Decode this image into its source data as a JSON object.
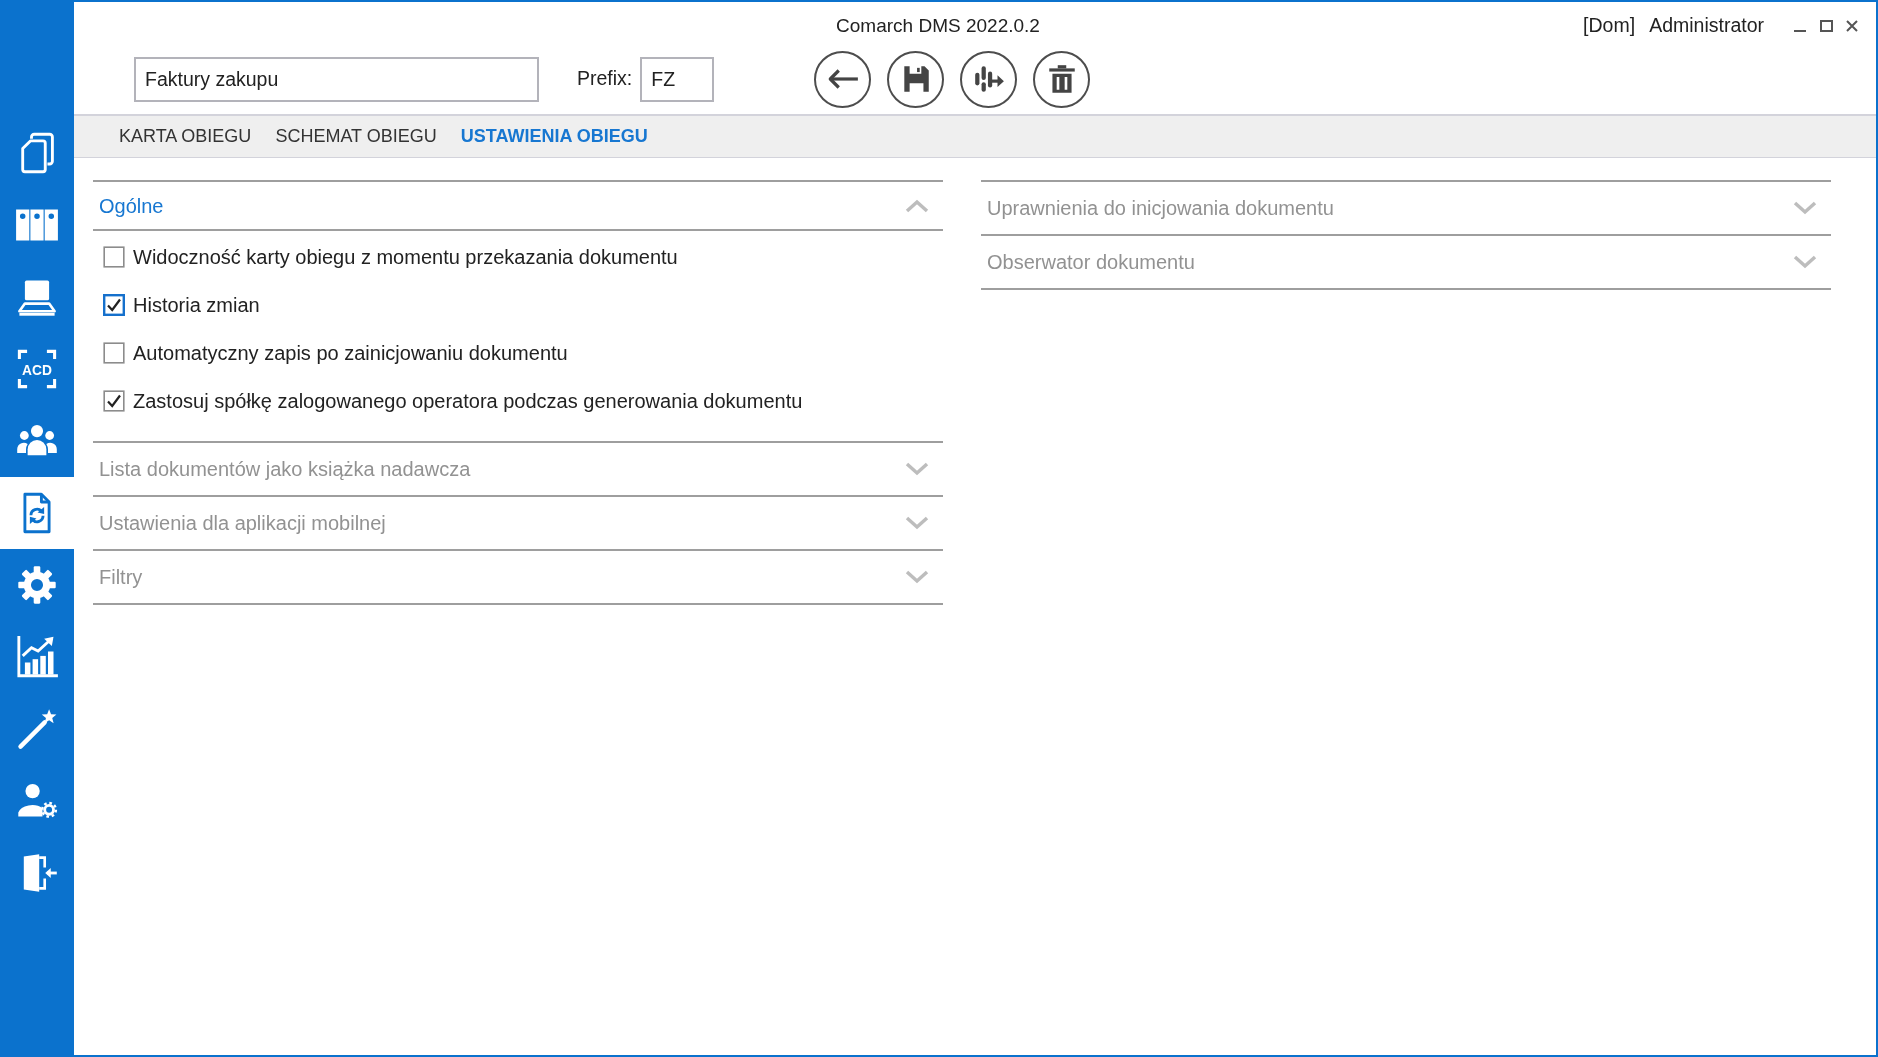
{
  "window": {
    "title": "Comarch DMS 2022.0.2",
    "context": "[Dom]",
    "user": "Administrator"
  },
  "sidebar": {
    "items": [
      {
        "kind": "copies",
        "selected": false
      },
      {
        "kind": "binders",
        "selected": false
      },
      {
        "kind": "scanner",
        "selected": false
      },
      {
        "kind": "ocr",
        "label": "ACD",
        "selected": false
      },
      {
        "kind": "users",
        "selected": false
      },
      {
        "kind": "workflow",
        "selected": true
      },
      {
        "kind": "settings",
        "selected": false
      },
      {
        "kind": "reports",
        "selected": false
      },
      {
        "kind": "wizard",
        "selected": false
      },
      {
        "kind": "admin",
        "selected": false
      },
      {
        "kind": "exit",
        "selected": false
      }
    ]
  },
  "toolbar": {
    "name_field": {
      "value": "Faktury zakupu"
    },
    "prefix_label": "Prefix:",
    "prefix_field": {
      "value": "FZ"
    },
    "buttons": [
      {
        "kind": "back"
      },
      {
        "kind": "save"
      },
      {
        "kind": "transfer"
      },
      {
        "kind": "delete"
      }
    ]
  },
  "tabs": [
    {
      "label": "KARTA OBIEGU",
      "selected": false
    },
    {
      "label": "SCHEMAT OBIEGU",
      "selected": false
    },
    {
      "label": "USTAWIENIA OBIEGU",
      "selected": true
    }
  ],
  "left_panel": {
    "sections": [
      {
        "title": "Ogólne",
        "expanded": true,
        "options": [
          {
            "label": "Widoczność karty obiegu z momentu przekazania dokumentu",
            "checked": false,
            "focused": false
          },
          {
            "label": "Historia zmian",
            "checked": true,
            "focused": true
          },
          {
            "label": "Automatyczny zapis po zainicjowaniu dokumentu",
            "checked": false,
            "focused": false
          },
          {
            "label": "Zastosuj spółkę zalogowanego operatora podczas generowania dokumentu",
            "checked": true,
            "focused": false
          }
        ]
      },
      {
        "title": "Lista dokumentów jako książka nadawcza",
        "expanded": false
      },
      {
        "title": "Ustawienia dla aplikacji mobilnej",
        "expanded": false
      },
      {
        "title": "Filtry",
        "expanded": false
      }
    ]
  },
  "right_panel": {
    "sections": [
      {
        "title": "Uprawnienia do inicjowania dokumentu",
        "expanded": false
      },
      {
        "title": "Obserwator dokumentu",
        "expanded": false
      }
    ]
  }
}
